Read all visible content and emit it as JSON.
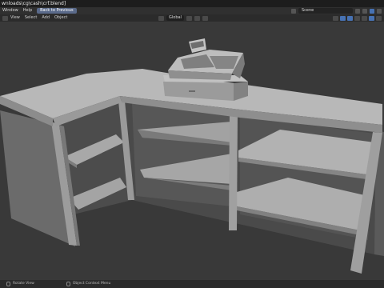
{
  "window": {
    "title": "wnloads\\cg\\cash\\crf.blend]"
  },
  "menubar": {
    "items": [
      "Window",
      "Help"
    ],
    "back_button": "Back to Previous",
    "scene": "Scene"
  },
  "viewport_header": {
    "left_items": [
      "View",
      "Select",
      "Add",
      "Object"
    ],
    "orientation": "Global"
  },
  "statusbar": {
    "items": [
      "Rotate View",
      "Object Context Menu"
    ]
  },
  "colors": {
    "accent": "#4772b3",
    "viewport_bg": "#393939",
    "model_light": "#b4b4b4",
    "model_dark": "#5f5f5f"
  }
}
